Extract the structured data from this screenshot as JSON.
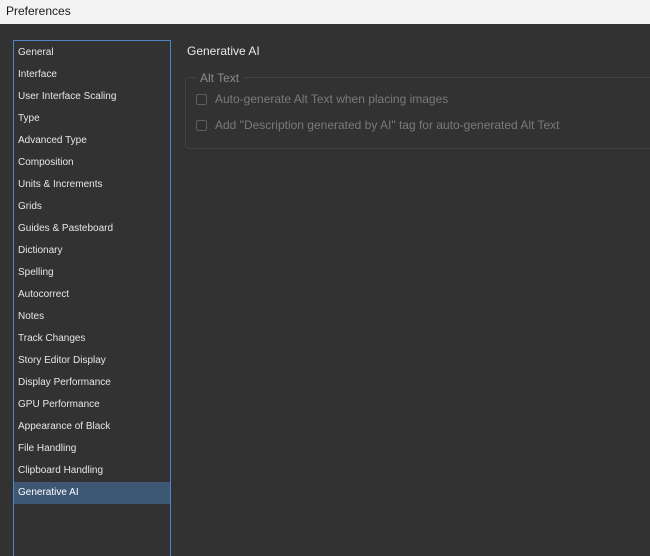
{
  "window": {
    "title": "Preferences"
  },
  "sidebar": {
    "items": [
      {
        "label": "General"
      },
      {
        "label": "Interface"
      },
      {
        "label": "User Interface Scaling"
      },
      {
        "label": "Type"
      },
      {
        "label": "Advanced Type"
      },
      {
        "label": "Composition"
      },
      {
        "label": "Units & Increments"
      },
      {
        "label": "Grids"
      },
      {
        "label": "Guides & Pasteboard"
      },
      {
        "label": "Dictionary"
      },
      {
        "label": "Spelling"
      },
      {
        "label": "Autocorrect"
      },
      {
        "label": "Notes"
      },
      {
        "label": "Track Changes"
      },
      {
        "label": "Story Editor Display"
      },
      {
        "label": "Display Performance"
      },
      {
        "label": "GPU Performance"
      },
      {
        "label": "Appearance of Black"
      },
      {
        "label": "File Handling"
      },
      {
        "label": "Clipboard Handling"
      },
      {
        "label": "Generative AI",
        "selected": true
      }
    ]
  },
  "main": {
    "section_title": "Generative AI",
    "alt_text_group": {
      "label": "Alt Text",
      "options": [
        {
          "label": "Auto-generate Alt Text when placing images",
          "checked": false,
          "enabled": false
        },
        {
          "label": "Add \"Description generated by AI\" tag for auto-generated Alt Text",
          "checked": false,
          "enabled": false
        }
      ]
    }
  },
  "colors": {
    "background": "#323232",
    "selection": "#3e5775",
    "focus_border": "#4d86c4"
  }
}
